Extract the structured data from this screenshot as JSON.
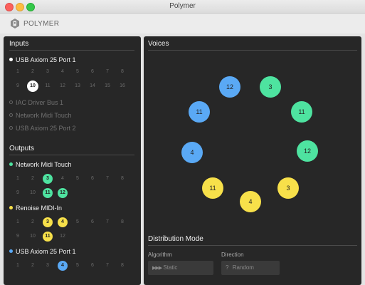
{
  "window": {
    "title": "Polymer"
  },
  "app": {
    "name": "POLYMER"
  },
  "inputs": {
    "title": "Inputs",
    "devices": [
      {
        "name": "USB Axiom 25 Port 1",
        "active": true,
        "color": "#ffffff",
        "channels": [
          "1",
          "2",
          "3",
          "4",
          "5",
          "6",
          "7",
          "8",
          "9",
          "10",
          "11",
          "12",
          "13",
          "14",
          "15",
          "16"
        ],
        "selected": [
          "10"
        ]
      },
      {
        "name": "IAC Driver Bus 1",
        "active": false
      },
      {
        "name": "Network Midi Touch",
        "active": false
      },
      {
        "name": "USB Axiom 25 Port 2",
        "active": false
      }
    ]
  },
  "outputs": {
    "title": "Outputs",
    "devices": [
      {
        "name": "Network Midi Touch",
        "color": "#4ee3a0",
        "channels": [
          "1",
          "2",
          "3",
          "4",
          "5",
          "6",
          "7",
          "8",
          "9",
          "10",
          "11",
          "12"
        ],
        "selected": [
          "3",
          "11",
          "12"
        ]
      },
      {
        "name": "Renoise MIDI-In",
        "color": "#f7e04a",
        "channels": [
          "1",
          "2",
          "3",
          "4",
          "5",
          "6",
          "7",
          "8",
          "9",
          "10",
          "11",
          "12"
        ],
        "selected": [
          "3",
          "4",
          "11"
        ]
      },
      {
        "name": "USB Axiom 25 Port 1",
        "color": "#5aa9f5",
        "channels": [
          "1",
          "2",
          "3",
          "4",
          "5",
          "6",
          "7",
          "8"
        ],
        "selected": [
          "4"
        ]
      }
    ]
  },
  "voices": {
    "title": "Voices",
    "items": [
      {
        "label": "12",
        "color": "#5aa9f5"
      },
      {
        "label": "3",
        "color": "#4ee3a0"
      },
      {
        "label": "11",
        "color": "#4ee3a0"
      },
      {
        "label": "12",
        "color": "#4ee3a0"
      },
      {
        "label": "3",
        "color": "#f7e04a"
      },
      {
        "label": "4",
        "color": "#f7e04a"
      },
      {
        "label": "11",
        "color": "#f7e04a"
      },
      {
        "label": "4",
        "color": "#5aa9f5"
      },
      {
        "label": "11",
        "color": "#5aa9f5"
      }
    ]
  },
  "distribution": {
    "title": "Distribution Mode",
    "algorithm_label": "Algorithm",
    "algorithm_value": "Static",
    "algorithm_icon": "arrows-icon",
    "direction_label": "Direction",
    "direction_value": "Random",
    "direction_icon": "question-icon"
  }
}
